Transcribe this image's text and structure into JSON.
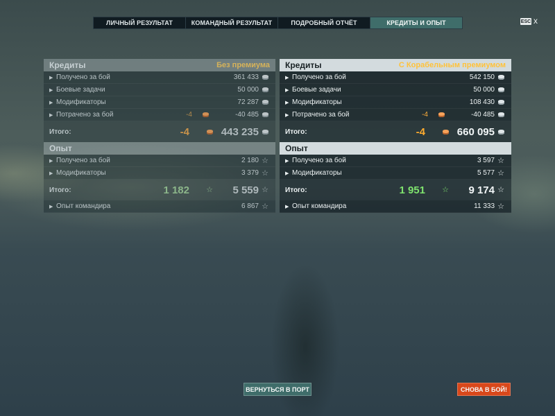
{
  "tabs": [
    {
      "label": "ЛИЧНЫЙ РЕЗУЛЬТАТ"
    },
    {
      "label": "КОМАНДНЫЙ РЕЗУЛЬТАТ"
    },
    {
      "label": "ПОДРОБНЫЙ ОТЧЁТ"
    },
    {
      "label": "КРЕДИТЫ И ОПЫТ"
    }
  ],
  "active_tab": "КРЕДИТЫ И ОПЫТ",
  "esc_label": "ESC",
  "close_glyph": "x",
  "left": {
    "credits_header": "Кредиты",
    "credits_note": "Без премиума",
    "credits_rows": [
      {
        "label": "Получено за бой",
        "neg": "",
        "value": "361 433"
      },
      {
        "label": "Боевые задачи",
        "neg": "",
        "value": "50 000"
      },
      {
        "label": "Модификаторы",
        "neg": "",
        "value": "72 287"
      },
      {
        "label": "Потрачено за бой",
        "neg": "-4",
        "value": "-40 485"
      }
    ],
    "credits_total_label": "Итого:",
    "credits_total_neg": "-4",
    "credits_total": "443 235",
    "xp_header": "Опыт",
    "xp_rows": [
      {
        "label": "Получено за бой",
        "value": "2 180"
      },
      {
        "label": "Модификаторы",
        "value": "3 379"
      }
    ],
    "xp_total_label": "Итого:",
    "xp_total_free": "1 182",
    "xp_total": "5 559",
    "commander_label": "Опыт командира",
    "commander_value": "6 867"
  },
  "right": {
    "credits_header": "Кредиты",
    "credits_note": "С Корабельным премиумом",
    "credits_rows": [
      {
        "label": "Получено за бой",
        "neg": "",
        "value": "542 150"
      },
      {
        "label": "Боевые задачи",
        "neg": "",
        "value": "50 000"
      },
      {
        "label": "Модификаторы",
        "neg": "",
        "value": "108 430"
      },
      {
        "label": "Потрачено за бой",
        "neg": "-4",
        "value": "-40 485"
      }
    ],
    "credits_total_label": "Итого:",
    "credits_total_neg": "-4",
    "credits_total": "660 095",
    "xp_header": "Опыт",
    "xp_rows": [
      {
        "label": "Получено за бой",
        "value": "3 597"
      },
      {
        "label": "Модификаторы",
        "value": "5 577"
      }
    ],
    "xp_total_label": "Итого:",
    "xp_total_free": "1 951",
    "xp_total": "9 174",
    "commander_label": "Опыт командира",
    "commander_value": "11 333"
  },
  "buttons": {
    "port": "ВЕРНУТЬСЯ В ПОРТ",
    "battle": "СНОВА В БОЙ!"
  },
  "colors": {
    "accent_teal": "#3f6d6a",
    "battle_orange": "#d9481b",
    "premium_gold": "#ffc23a",
    "free_xp_green": "#7fe36e",
    "coal_orange": "#ffac2e"
  }
}
